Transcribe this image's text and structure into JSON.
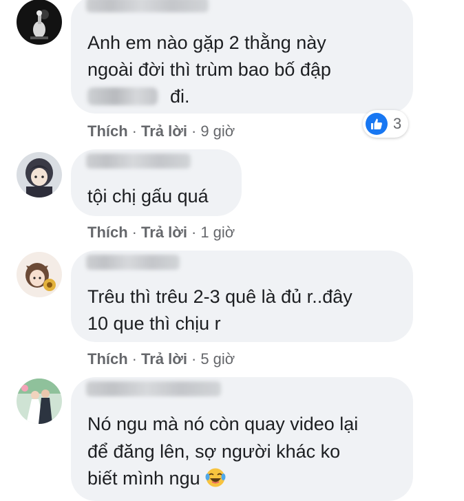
{
  "comments": [
    {
      "text_lines": [
        "Anh em nào gặp 2 thằng này",
        "ngoài đời thì trùm bao bố đập",
        "đi."
      ],
      "actions": {
        "like": "Thích",
        "reply": "Trả lời",
        "time": "9 giờ"
      },
      "reactions": {
        "icon": "like-icon",
        "count": "3",
        "color": "#1877f2"
      }
    },
    {
      "text_lines": [
        "tội chị gấu quá"
      ],
      "actions": {
        "like": "Thích",
        "reply": "Trả lời",
        "time": "1 giờ"
      }
    },
    {
      "text_lines": [
        "Trêu thì trêu 2-3 quê là đủ r..đây",
        "10 que thì chịu r"
      ],
      "actions": {
        "like": "Thích",
        "reply": "Trả lời",
        "time": "5 giờ"
      }
    },
    {
      "text_lines": [
        "Nó ngu mà nó còn quay video lại",
        "để đăng lên, sợ người khác ko",
        "biết mình ngu"
      ],
      "emoji": "laughing-tears-emoji"
    }
  ],
  "separator": "·",
  "colors": {
    "bubble_bg": "#f0f2f5",
    "meta_text": "#65676b",
    "like_blue": "#1877f2",
    "body_text": "#1c1e21"
  }
}
